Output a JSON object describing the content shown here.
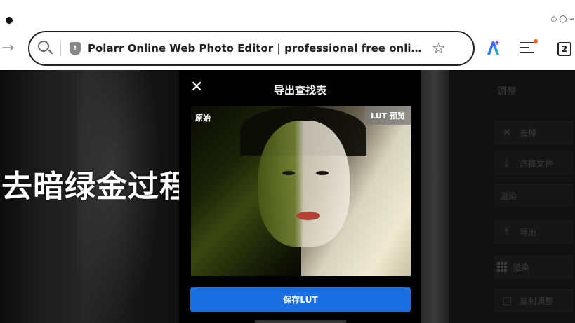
{
  "browser": {
    "url_text": "Polarr Online Web Photo Editor | professional free onli…",
    "tabs_count": "2"
  },
  "editor": {
    "overlay_caption": "去暗绿金过程"
  },
  "modal": {
    "title": "导出查找表",
    "close_glyph": "✕",
    "label_original": "原始",
    "label_lut_preview": "LUT 预览",
    "save_button": "保存LUT"
  },
  "panel": {
    "title": "调整",
    "items": [
      {
        "label": "去掉",
        "icon": "close-icon"
      },
      {
        "label": "选择文件",
        "icon": "download-icon"
      },
      {
        "label": "渲染",
        "icon": ""
      },
      {
        "label": "导出",
        "icon": "upload-icon"
      },
      {
        "label": "渲染",
        "icon": "grid-icon"
      },
      {
        "label": "复制调整",
        "icon": "copy-icon"
      }
    ]
  },
  "colors": {
    "save_button_bg": "#1a6fe0",
    "modal_bg": "#000000",
    "menu_notification_dot": "#ff5a1f"
  }
}
